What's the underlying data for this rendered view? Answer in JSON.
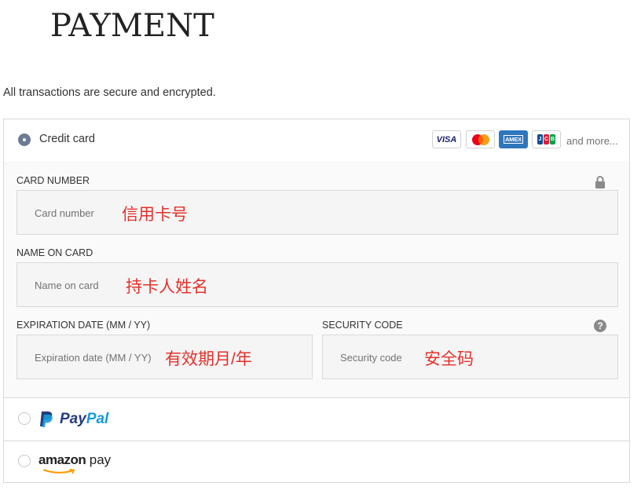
{
  "page": {
    "title": "PAYMENT",
    "secure_note": "All transactions are secure and encrypted."
  },
  "payment_methods": {
    "credit_card": {
      "label": "Credit card",
      "selected": true,
      "brands": [
        "VISA",
        "Mastercard",
        "AMEX",
        "JCB"
      ],
      "brand_labels": {
        "visa": "VISA",
        "amex": "AMEX"
      },
      "and_more": "and more..."
    },
    "paypal": {
      "label_pay": "Pay",
      "label_pal": "Pal",
      "selected": false
    },
    "amazon_pay": {
      "label_amazon": "amazon",
      "label_pay": "pay",
      "selected": false
    }
  },
  "form": {
    "card_number": {
      "label": "CARD NUMBER",
      "placeholder": "Card number",
      "annotation": "信用卡号",
      "icon": "lock-icon"
    },
    "name_on_card": {
      "label": "NAME ON CARD",
      "placeholder": "Name on card",
      "annotation": "持卡人姓名"
    },
    "expiration": {
      "label": "EXPIRATION DATE (MM / YY)",
      "placeholder": "Expiration date (MM / YY)",
      "annotation": "有效期月/年"
    },
    "security_code": {
      "label": "SECURITY CODE",
      "placeholder": "Security code",
      "annotation": "安全码",
      "help_glyph": "?",
      "icon": "help-icon"
    }
  },
  "colors": {
    "annotation": "#e4312b",
    "radio_selected": "#6b7c93",
    "paypal_dark": "#253b80",
    "paypal_light": "#179bd7",
    "amazon_orange": "#ff9900",
    "amex_blue": "#2e77bc",
    "visa_blue": "#1a1f71"
  }
}
